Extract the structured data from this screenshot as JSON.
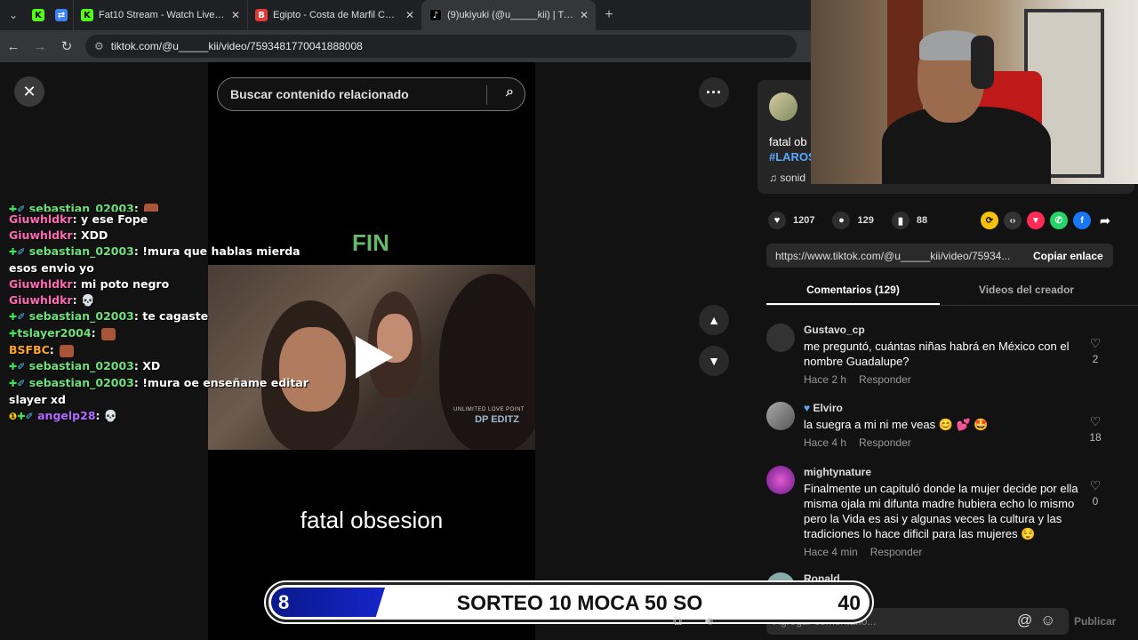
{
  "browser": {
    "tabs": [
      {
        "title": "Fat10 Stream - Watch Live on K",
        "favicon": "kick-icon"
      },
      {
        "title": "Egipto - Costa de Marfil Cuotas",
        "favicon": "betting-icon"
      },
      {
        "title": "(9)ukiyuki (@u_____kii) | TikTok",
        "favicon": "tiktok-icon",
        "active": true
      }
    ],
    "url": "tiktok.com/@u_____kii/video/7593481770041888008"
  },
  "player": {
    "search_placeholder": "Buscar contenido relacionado",
    "fin_text": "FIN",
    "caption": "fatal obsesion",
    "watermark_small": "UNLIMITED LOVE POINT",
    "watermark": "DP EDITZ"
  },
  "post": {
    "description": "fatal ob",
    "hashtag": "#LAROS",
    "sound": "sonid",
    "likes": "1207",
    "comments": "129",
    "saves": "88",
    "link": "https://www.tiktok.com/@u_____kii/video/75934...",
    "copy_label": "Copiar enlace",
    "tab_comments": "Comentarios (129)",
    "tab_videos": "Videos del creador",
    "add_comment_placeholder": "Agregar comentario...",
    "publish_label": "Publicar"
  },
  "comments": [
    {
      "user": "Gustavo_cp",
      "text": "me preguntó, cuántas niñas habrá en México con el nombre Guadalupe?",
      "time": "Hace 2 h",
      "reply": "Responder",
      "likes": "2"
    },
    {
      "user": "Elviro",
      "text": "la suegra a mi ni me veas 😊 💕 🤩",
      "time": "Hace 4 h",
      "reply": "Responder",
      "likes": "18"
    },
    {
      "user": "mightynature",
      "text": "Finalmente un capituló donde la mujer decide por ella misma ojala mi difunta madre hubiera echo lo mismo pero la Vida es asi y algunas veces la cultura y las tradiciones lo hace dificil para las mujeres 😌",
      "time": "Hace 4 min",
      "reply": "Responder",
      "likes": "0"
    },
    {
      "user": "Ronald",
      "text": "",
      "time": "",
      "reply": "",
      "likes": ""
    }
  ],
  "chat": [
    {
      "user": "sebastian_02003",
      "msg": "",
      "color": "#6ee07c"
    },
    {
      "user": "Giuwhldkr",
      "msg": "y ese Fope",
      "color": "#ff69b4"
    },
    {
      "user": "Giuwhldkr",
      "msg": "XDD",
      "color": "#ff69b4"
    },
    {
      "user": "sebastian_02003",
      "msg": "!mura que hablas mierda",
      "color": "#6ee07c"
    },
    {
      "user": "",
      "msg": "esos envio yo",
      "color": "#ffffff"
    },
    {
      "user": "Giuwhldkr",
      "msg": "mi poto negro",
      "color": "#ff69b4"
    },
    {
      "user": "Giuwhldkr",
      "msg": "💀",
      "color": "#ff69b4"
    },
    {
      "user": "sebastian_02003",
      "msg": "te cagaste",
      "color": "#6ee07c"
    },
    {
      "user": "tslayer2004",
      "msg": "",
      "color": "#6ee07c"
    },
    {
      "user": "BSFBC",
      "msg": "",
      "color": "#ffa42c"
    },
    {
      "user": "sebastian_02003",
      "msg": "XD",
      "color": "#6ee07c"
    },
    {
      "user": "sebastian_02003",
      "msg": "!mura oe enseñame editar",
      "color": "#6ee07c"
    },
    {
      "user": "",
      "msg": "slayer xd",
      "color": "#ffffff"
    },
    {
      "user": "angelp28",
      "msg": "💀",
      "color": "#b26bff"
    }
  ],
  "sorteo": {
    "left_number": "8",
    "text": "SORTEO 10 MOCA 50 SO",
    "right_number": "40"
  },
  "colors": {
    "accent_blue": "#1424c9",
    "tiktok_link": "#5aa9ff",
    "chat_pink": "#ff69b4",
    "chat_green": "#6ee07c"
  }
}
